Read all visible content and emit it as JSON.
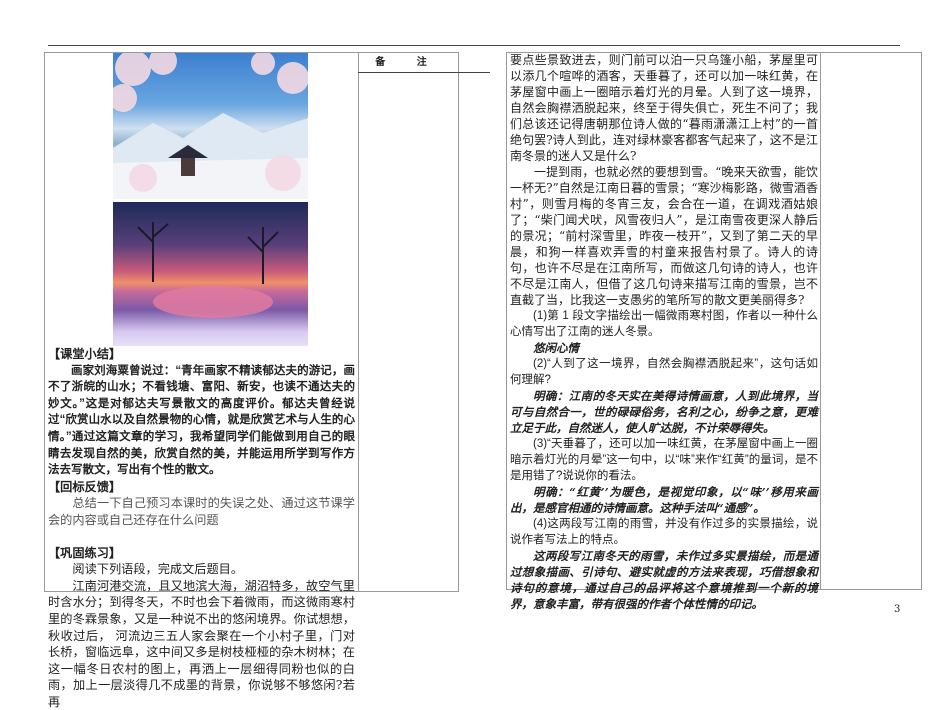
{
  "header_remark": "备 注",
  "images": {
    "top": "snowy-mountain-pagoda-blossom",
    "bottom": "sunset-snow-lake-trees"
  },
  "left": {
    "summary_title": "【课堂小结】",
    "summary_text": "画家刘海粟曾说过：“青年画家不精读郁达夫的游记，画不了浙皖的山水；不看钱塘、富阳、新安，也读不通达夫的妙文。”这是对郁达夫写景散文的高度评价。郁达夫曾经说过“欣赏山水以及自然景物的心情，就是欣赏艺术与人生的心情。”通过这篇文章的学习，我希望同学们能做到用自己的眼睛去发现自然的美，欣赏自然的美，并能运用所学到写作方法去写散文，写出有个性的散文。",
    "feedback_title": "【回标反馈】",
    "feedback_text": "总结一下自己预习本课时的失误之处、通过这节课学会的内容或自己还存在什么问题",
    "practice_title": "【巩固练习】",
    "practice_intro": "阅读下列语段，完成文后题目。",
    "practice_text": "江南河港交流，且又地滨大海，湖沼特多，故空气里时含水分；到得冬天，不时也会下着微雨，而这微雨寒村里的冬霖景象，又是一种说不出的悠闲境界。你试想想，秋收过后， 河流边三五人家会聚在一个小村子里，门对长桥，窗临远阜，这中间又多是树枝桠桠的杂木树林；在这一幅冬日农村的图上，再洒上一层细得同粉也似的白雨，加上一层淡得几不成墨的背景，你说够不够悠闲?若再"
  },
  "right": {
    "p1": "要点些景致进去，则门前可以泊一只乌篷小船，茅屋里可以添几个喧哗的酒客，天垂暮了，还可以加一味红黄，在茅屋窗中画上一圈暗示着灯光的月晕。人到了这一境界，自然会胸襟洒脱起来，终至于得失俱亡，死生不问了；我们总该还记得唐朝那位诗人做的“暮雨潇潇江上村”的一首绝句罢?诗人到此，连对绿林豪客都客气起来了，这不是江南冬景的迷人又是什么?",
    "p2": "一提到雨，也就必然的要想到雪。“晚来天欲雪，能饮一杯无?”自然是江南日暮的雪景；“寒沙梅影路，微雪酒香村”，则雪月梅的冬宵三友，会合在一道，在调戏酒姑娘了；“柴门闻犬吠，风雪夜归人”，是江南雪夜更深人静后的景况；“前村深雪里，昨夜一枝开”，又到了第二天的早晨，和狗一样喜欢弄雪的村童来报告村景了。诗人的诗句，也许不尽是在江南所写，而做这几句诗的诗人，也许不尽是江南人，但借了这几句诗来描写江南的雪景，岂不直截了当，比我这一支愚劣的笔所写的散文更美丽得多?",
    "q1": "(1)第 1 段文字描绘出一幅微雨寒村图，作者以一种什么心情写出了江南的迷人冬景。",
    "a1": "悠闲心情",
    "q2": "(2)“人到了这一境界，自然会胸襟洒脱起来”，这句话如何理解?",
    "a2": "明确：江南的冬天实在美得诗情画意，人到此境界，当可与自然合一，世的碌碌俗务，名利之心，纷争之意，更难立足于此，自然迷人，使人旷达脱，不计荣辱得失。",
    "q3": "(3)“天垂暮了，还可以加一味红黄，在茅屋窗中画上一圈暗示着灯光的月晕”这一句中，以“味”来作“红黄”的量词，是不是用错了?说说你的看法。",
    "a3": "明确：“红黄’’为暖色，是视觉印象，以“味’’移用来画出，是感官相通的诗情画意。这种手法叫“通感”。",
    "q4": "(4)这两段写江南的雨雪，并没有作过多的实景描绘，说说作者写法上的特点。",
    "a4": "这两段写江南冬天的雨雪，未作过多实景描绘，而是通过想象描画、引诗句、避实就虚的方法来表现，巧借想象和诗句的意境，通过自己的品评将这个意境推到一个新的境界，意象丰富，带有很强的作者个体性情的印记。"
  },
  "page_number": "3"
}
